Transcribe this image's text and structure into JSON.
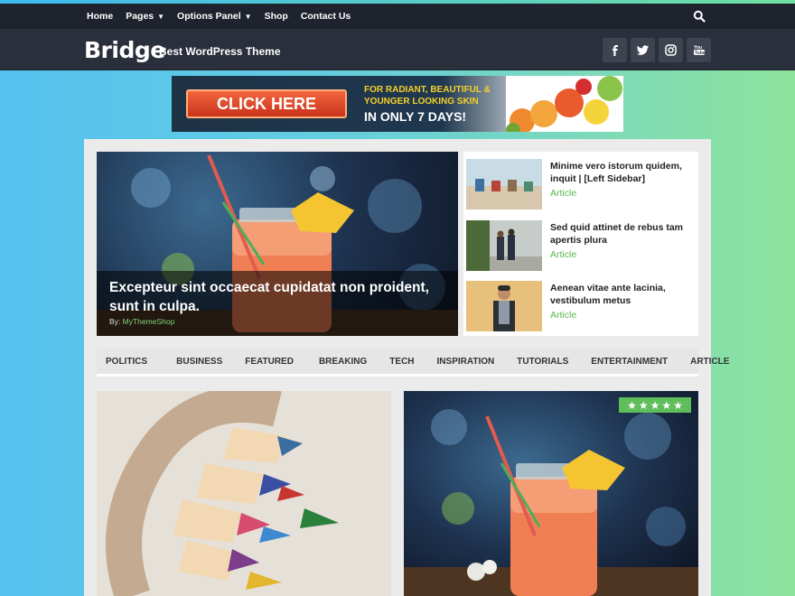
{
  "nav": {
    "items": [
      {
        "label": "Home",
        "dropdown": false
      },
      {
        "label": "Pages",
        "dropdown": true
      },
      {
        "label": "Options Panel",
        "dropdown": true
      },
      {
        "label": "Shop",
        "dropdown": false
      },
      {
        "label": "Contact Us",
        "dropdown": false
      }
    ],
    "search_icon": "search-icon"
  },
  "header": {
    "logo": "Bridge",
    "tagline": "Best WordPress Theme",
    "social": [
      "facebook-icon",
      "twitter-icon",
      "instagram-icon",
      "youtube-icon"
    ]
  },
  "ad": {
    "button": "CLICK HERE",
    "line1": "FOR RADIANT, BEAUTIFUL &",
    "line2": "YOUNGER LOOKING SKIN",
    "line3": "IN ONLY 7 DAYS!"
  },
  "hero": {
    "title": "Excepteur sint occaecat cupidatat non proident, sunt in culpa.",
    "by_prefix": "By: ",
    "author": "MyThemeShop"
  },
  "side_posts": [
    {
      "title": "Minime vero istorum quidem, inquit | [Left Sidebar]",
      "category": "Article"
    },
    {
      "title": "Sed quid attinet de rebus tam apertis plura",
      "category": "Article"
    },
    {
      "title": "Aenean vitae ante lacinia, vestibulum metus",
      "category": "Article"
    }
  ],
  "categories": [
    "POLITICS",
    "BUSINESS",
    "FEATURED",
    "BREAKING",
    "TECH",
    "INSPIRATION",
    "TUTORIALS",
    "ENTERTAINMENT",
    "ARTICLE"
  ],
  "rating": {
    "stars": 5,
    "max": 5
  },
  "colors": {
    "accent": "#5fbd5a",
    "nav_bg": "#1f232d",
    "header_bg": "#2a2f3c"
  }
}
